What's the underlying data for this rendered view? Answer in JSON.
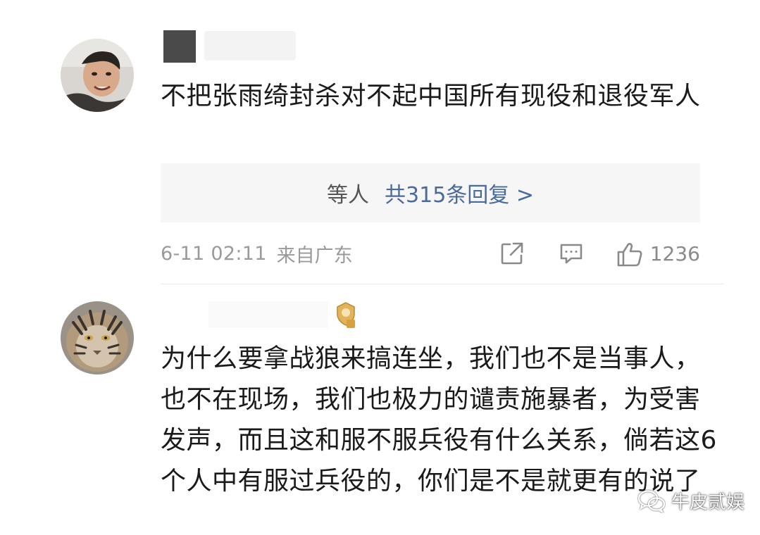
{
  "comments": [
    {
      "text": "不把张雨绮封杀对不起中国所有现役和退役军人",
      "replies": {
        "replier": "等人",
        "count_text": "共315条回复 >"
      },
      "timestamp": "6-11 02:11",
      "location": "来自广东",
      "likes": "1236"
    },
    {
      "text": "为什么要拿战狼来搞连坐，我们也不是当事人，也不在现场，我们也极力的谴责施暴者，为受害发声，而且这和服不服兵役有什么关系，倘若这6个人中有服过兵役的，你们是不是就更有的说了"
    }
  ],
  "watermark": {
    "label": "牛皮贰娱"
  },
  "colors": {
    "link": "#4a6a9a",
    "meta": "#9a9a9a",
    "reply_bg": "#f6f6f6"
  },
  "icons": {
    "share": "share-icon",
    "comment": "comment-icon",
    "like": "thumbs-up-icon",
    "badge": "fan-badge-icon",
    "watermark": "wechat-icon"
  }
}
